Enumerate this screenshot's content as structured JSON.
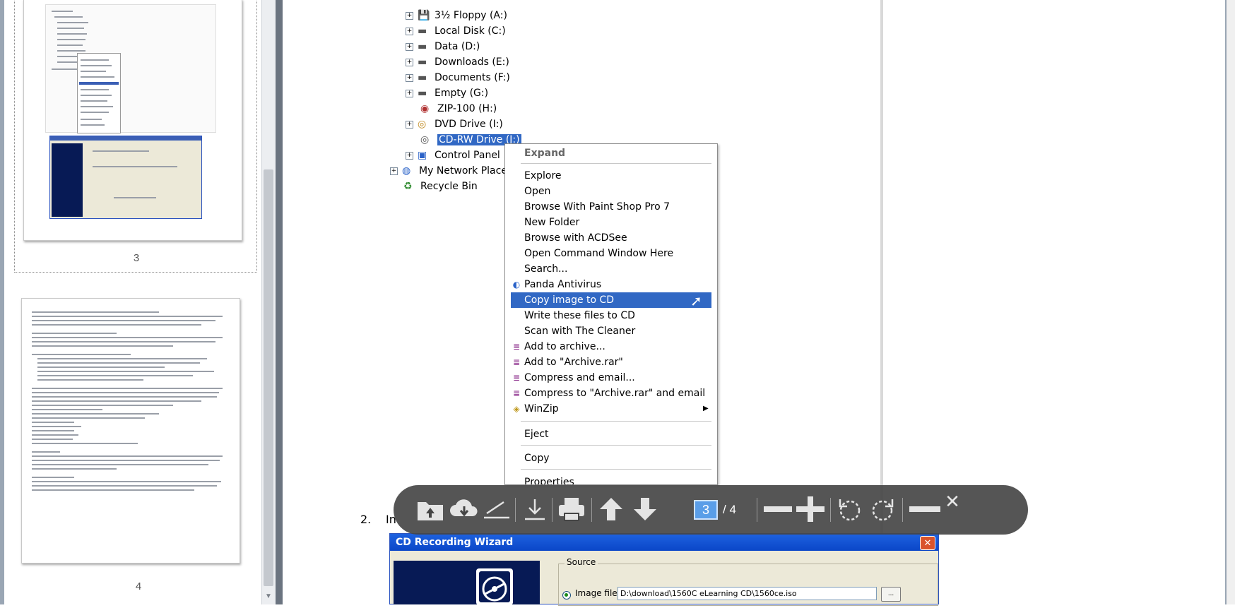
{
  "sidebar": {
    "thumbnails": [
      {
        "page_label": "3"
      },
      {
        "page_label": "4"
      }
    ]
  },
  "tree": {
    "items": [
      {
        "label": "3½ Floppy (A:)",
        "icon": "floppy-drive-icon"
      },
      {
        "label": "Local Disk (C:)",
        "icon": "hard-disk-icon"
      },
      {
        "label": "Data (D:)",
        "icon": "hard-disk-icon"
      },
      {
        "label": "Downloads (E:)",
        "icon": "hard-disk-icon"
      },
      {
        "label": "Documents (F:)",
        "icon": "hard-disk-icon"
      },
      {
        "label": "Empty (G:)",
        "icon": "hard-disk-icon"
      },
      {
        "label": "ZIP-100 (H:)",
        "icon": "zip-drive-icon"
      },
      {
        "label": "DVD Drive (I:)",
        "icon": "dvd-drive-icon"
      },
      {
        "label": "CD-RW Drive (J:)",
        "icon": "cd-drive-icon"
      },
      {
        "label": "Control Panel",
        "icon": "control-panel-icon"
      },
      {
        "label": "My Network Places",
        "icon": "network-places-icon"
      },
      {
        "label": "Recycle Bin",
        "icon": "recycle-bin-icon"
      }
    ]
  },
  "context_menu": {
    "items": [
      {
        "label": "Expand",
        "bold": true
      },
      {
        "label": "Explore"
      },
      {
        "label": "Open"
      },
      {
        "label": "Browse With Paint Shop Pro 7"
      },
      {
        "label": "New Folder"
      },
      {
        "label": "Browse with ACDSee"
      },
      {
        "label": "Open Command Window Here"
      },
      {
        "label": "Search..."
      },
      {
        "label": "Panda Antivirus",
        "icon": "panda-antivirus-icon"
      },
      {
        "label": "Copy image to CD",
        "highlighted": true
      },
      {
        "label": "Write these files to CD"
      },
      {
        "label": "Scan with The Cleaner"
      },
      {
        "label": "Add to archive...",
        "icon": "winrar-icon"
      },
      {
        "label": "Add to \"Archive.rar\"",
        "icon": "winrar-icon"
      },
      {
        "label": "Compress and email...",
        "icon": "winrar-icon"
      },
      {
        "label": "Compress to \"Archive.rar\" and email",
        "icon": "winrar-icon"
      },
      {
        "label": "WinZip",
        "icon": "winzip-icon",
        "submenu": true
      },
      {
        "label": "Eject"
      },
      {
        "label": "Copy"
      },
      {
        "label": "Properties"
      }
    ],
    "highlight_color": "#3168c4"
  },
  "toolbar": {
    "buttons": [
      "open-folder-icon",
      "cloud-download-icon",
      "sign-icon",
      "download-icon",
      "print-icon",
      "previous-page-icon",
      "next-page-icon",
      "zoom-out-icon",
      "zoom-in-icon",
      "rotate-ccw-icon",
      "rotate-cw-icon",
      "minimize-icon",
      "close-icon"
    ],
    "current_page": "3",
    "total_pages": "/ 4"
  },
  "document": {
    "step_number": "2.",
    "step_text": "In",
    "wizard": {
      "title": "CD Recording Wizard",
      "source_label": "Source",
      "image_file_label": "Image file",
      "image_path": "D:\\download\\1560C eLearning CD\\1560ce.iso",
      "browse_label": "..."
    }
  }
}
